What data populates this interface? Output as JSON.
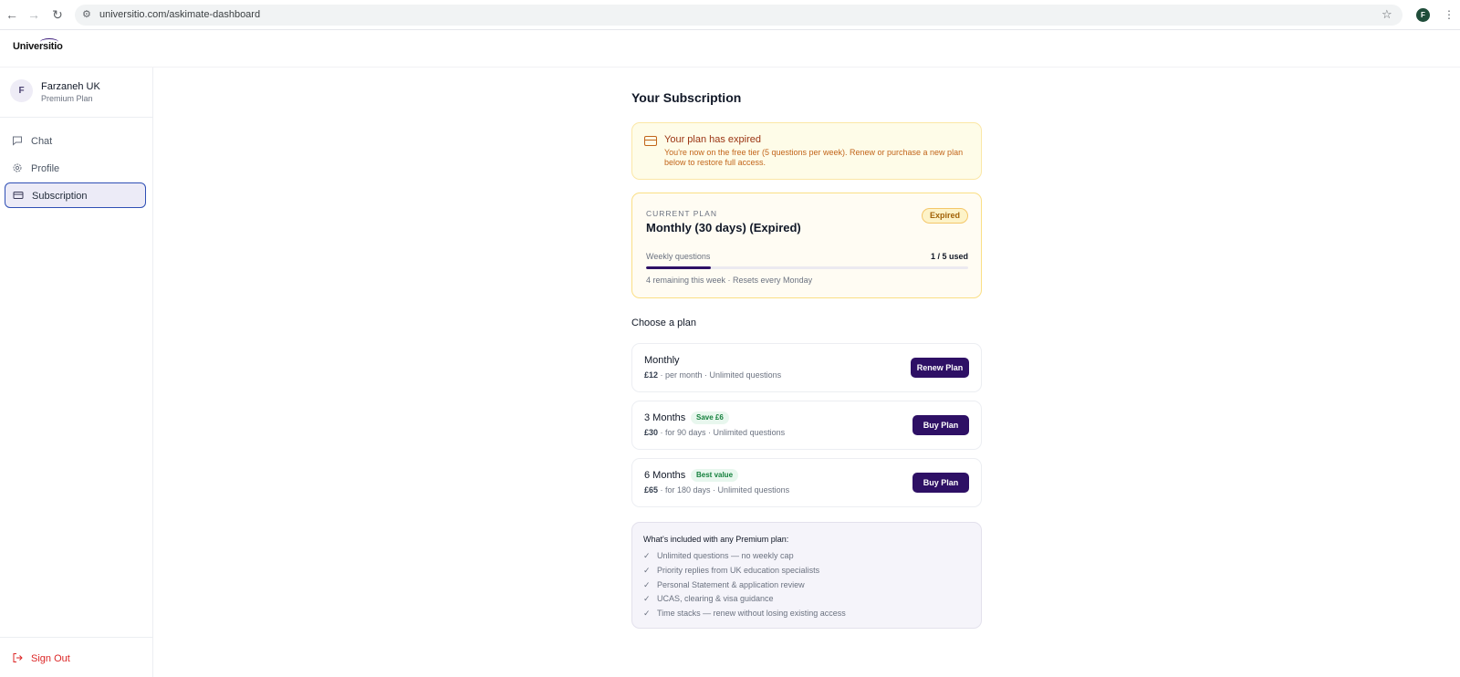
{
  "browser": {
    "url": "universitio.com/askimate-dashboard",
    "profile_initial": "F"
  },
  "app": {
    "logo": "Universitio"
  },
  "user": {
    "initial": "F",
    "name": "Farzaneh UK",
    "plan": "Premium Plan"
  },
  "sidebar": {
    "items": [
      {
        "label": "Chat",
        "icon": "chat-bubble-icon"
      },
      {
        "label": "Profile",
        "icon": "gear-icon"
      },
      {
        "label": "Subscription",
        "icon": "credit-card-icon",
        "active": true
      }
    ],
    "sign_out": "Sign Out"
  },
  "main": {
    "title": "Your Subscription",
    "alert": {
      "title": "Your plan has expired",
      "body": "You're now on the free tier (5 questions per week). Renew or purchase a new plan below to restore full access."
    },
    "current_plan": {
      "label": "CURRENT PLAN",
      "title": "Monthly (30 days) (Expired)",
      "badge": "Expired",
      "usage_label": "Weekly questions",
      "usage_text": "1 / 5 used",
      "usage_fraction": 0.2,
      "hint": "4 remaining this week · Resets every Monday"
    },
    "choose_title": "Choose a plan",
    "plans": [
      {
        "name": "Monthly",
        "badge": "",
        "price": "£12",
        "detail": " · per month · Unlimited questions",
        "button": "Renew Plan"
      },
      {
        "name": "3 Months",
        "badge": "Save £6",
        "price": "£30",
        "detail": " · for 90 days · Unlimited questions",
        "button": "Buy Plan"
      },
      {
        "name": "6 Months",
        "badge": "Best value",
        "price": "£65",
        "detail": " · for 180 days · Unlimited questions",
        "button": "Buy Plan"
      }
    ],
    "included": {
      "title": "What's included with any Premium plan:",
      "items": [
        "Unlimited questions — no weekly cap",
        "Priority replies from UK education specialists",
        "Personal Statement & application review",
        "UCAS, clearing & visa guidance",
        "Time stacks — renew without losing existing access"
      ]
    }
  },
  "colors": {
    "brand": "#2e1065",
    "warning": "#c2651a",
    "danger": "#dc2626",
    "success": "#15803d"
  }
}
